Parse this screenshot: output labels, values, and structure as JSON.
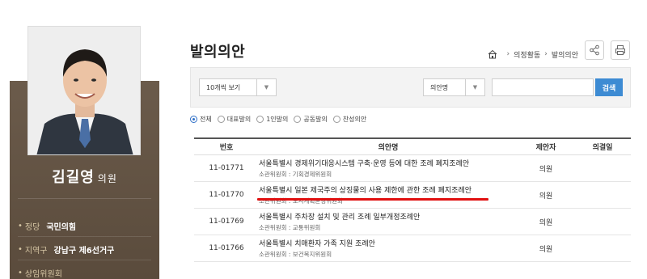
{
  "profile": {
    "name": "김길영",
    "title_suffix": "의원",
    "info": [
      {
        "key": "정당",
        "value": "국민의힘"
      },
      {
        "key": "지역구",
        "value": "강남구 제6선거구"
      },
      {
        "key": "상임위원회",
        "value": ""
      }
    ]
  },
  "page": {
    "title": "발의의안",
    "breadcrumb": [
      "의정활동",
      "발의의안"
    ]
  },
  "filters": {
    "page_size": "10개씩 보기",
    "search_field": "의안명",
    "search_value": "",
    "search_button": "검색"
  },
  "radio_filters": [
    {
      "label": "전체",
      "selected": true
    },
    {
      "label": "대표발의",
      "selected": false
    },
    {
      "label": "1인발의",
      "selected": false
    },
    {
      "label": "공동발의",
      "selected": false
    },
    {
      "label": "찬성의안",
      "selected": false
    }
  ],
  "table": {
    "headers": [
      "번호",
      "의안명",
      "제안자",
      "의결일"
    ],
    "rows": [
      {
        "no": "11-01771",
        "title": "서울특별시 경제위기대응시스템 구축·운영 등에 대한 조례 폐지조례안",
        "committee": "소관위원회 : 기획경제위원회",
        "proposer": "의원",
        "result": ""
      },
      {
        "no": "11-01770",
        "title": "서울특별시 일본 제국주의 상징물의 사용 제한에 관한 조례 폐지조례안",
        "committee": "소관위원회 : 도시계획균형위원회",
        "proposer": "의원",
        "result": ""
      },
      {
        "no": "11-01769",
        "title": "서울특별시 주차장 설치 및 관리 조례 일부개정조례안",
        "committee": "소관위원회 : 교통위원회",
        "proposer": "의원",
        "result": ""
      },
      {
        "no": "11-01766",
        "title": "서울특별시 치매환자 가족 지원 조례안",
        "committee": "소관위원회 : 보건복지위원회",
        "proposer": "의원",
        "result": ""
      }
    ]
  },
  "colors": {
    "profile_panel": "#5f4f40",
    "accent_label": "#d7c7a5",
    "search_button": "#3d8bd3",
    "highlight_underline": "#e01010"
  }
}
